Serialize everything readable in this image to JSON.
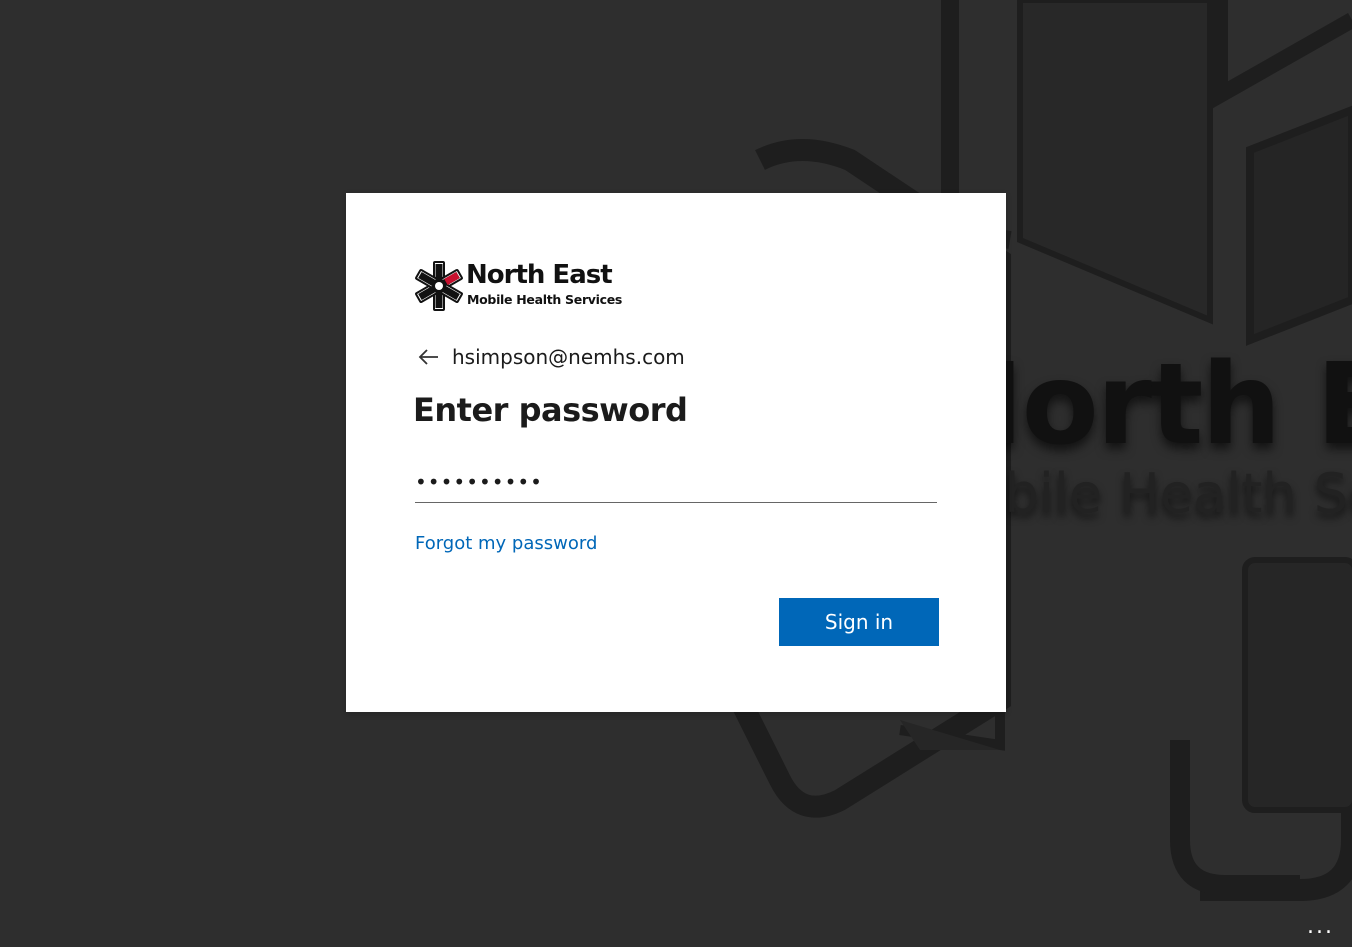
{
  "background": {
    "title": "North East",
    "subtitle": "Mobile Health Services"
  },
  "brand": {
    "name": "North East",
    "tagline": "Mobile Health Services",
    "accent": "#c8102e"
  },
  "identity": {
    "email": "hsimpson@nemhs.com",
    "back_icon": "back-arrow-icon"
  },
  "form": {
    "heading": "Enter password",
    "password_value": "••••••••••",
    "forgot_link": "Forgot my password",
    "submit_label": "Sign in"
  },
  "footer": {
    "more_label": "..."
  },
  "colors": {
    "primary": "#0067b8",
    "page_background": "#2e2e2e"
  }
}
